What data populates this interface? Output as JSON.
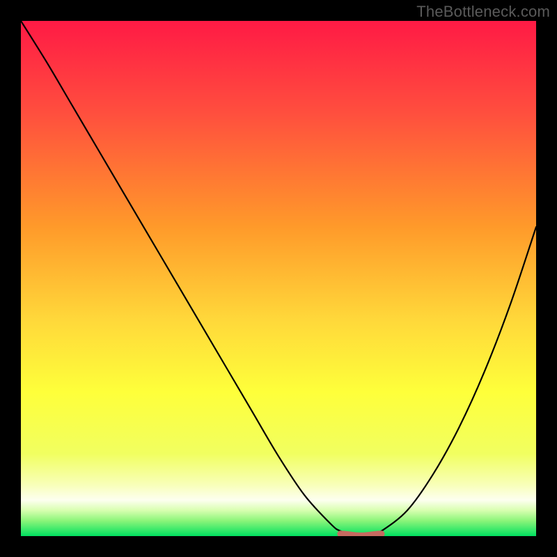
{
  "watermark": "TheBottleneck.com",
  "colors": {
    "black": "#000000",
    "curve": "#000000",
    "marker_fill": "#c66a60",
    "marker_stroke": "#b94f45",
    "grad_top": "#ff1a45",
    "grad_mid1": "#ff8a2a",
    "grad_mid2": "#ffe53a",
    "grad_low": "#f6ff60",
    "grad_cream": "#fbffd0",
    "grad_green": "#00e060"
  },
  "chart_data": {
    "type": "line",
    "title": "",
    "xlabel": "",
    "ylabel": "",
    "xlim": [
      0,
      100
    ],
    "ylim": [
      0,
      100
    ],
    "series": [
      {
        "name": "bottleneck-curve",
        "x": [
          0,
          5,
          10,
          15,
          20,
          25,
          30,
          35,
          40,
          45,
          50,
          55,
          60,
          62,
          65,
          68,
          70,
          75,
          80,
          85,
          90,
          95,
          100
        ],
        "values": [
          100,
          92,
          83.5,
          75,
          66.5,
          58,
          49.5,
          41,
          32.5,
          24,
          15.5,
          8,
          2.5,
          1,
          0.3,
          0.3,
          1,
          5,
          12,
          21,
          32,
          45,
          60
        ]
      }
    ],
    "annotations": [
      {
        "name": "optimum-marker",
        "shape": "rounded-segment",
        "x_range": [
          62,
          70
        ],
        "y": 0.3
      }
    ]
  }
}
